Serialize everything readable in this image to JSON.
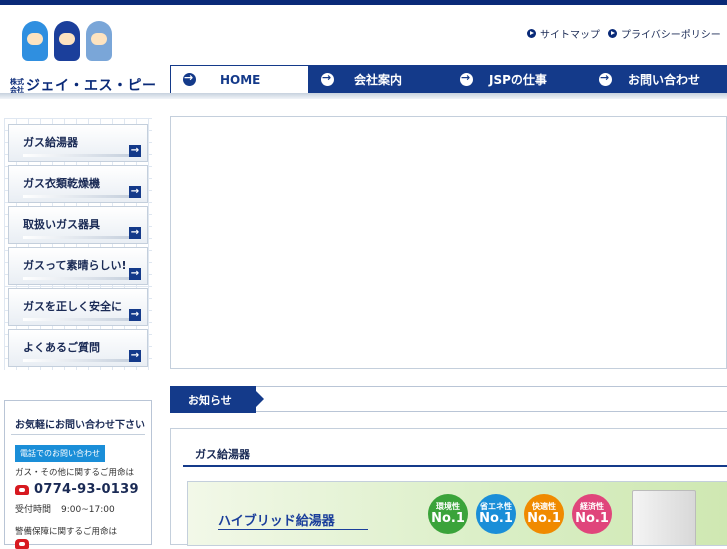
{
  "logo": {
    "company_prefix": "株式会社",
    "company_name": "ジェイ・エス・ピー"
  },
  "utility_links": [
    {
      "label": "サイトマップ"
    },
    {
      "label": "プライバシーポリシー"
    }
  ],
  "nav": [
    {
      "label": "HOME",
      "active": true
    },
    {
      "label": "会社案内",
      "active": false
    },
    {
      "label": "JSPの仕事",
      "active": false
    },
    {
      "label": "お問い合わせ",
      "active": false
    }
  ],
  "sidebar": {
    "items": [
      {
        "label": "ガス給湯器"
      },
      {
        "label": "ガス衣類乾燥機"
      },
      {
        "label": "取扱いガス器具"
      },
      {
        "label": "ガスって素晴らしい!"
      },
      {
        "label": "ガスを正しく安全に"
      },
      {
        "label": "よくあるご質問"
      }
    ]
  },
  "contact": {
    "title": "お気軽にお問い合わせ下さい",
    "badge": "電話でのお問い合わせ",
    "note1": "ガス・その他に関するご用命は",
    "phone1": "0774-93-0139",
    "hours_label": "受付時間",
    "hours_value": "9:00~17:00",
    "note2": "警備保障に関するご用命は"
  },
  "news": {
    "label": "お知らせ"
  },
  "section": {
    "title": "ガス給湯器",
    "banner_title": "ハイブリッド給湯器",
    "badges": [
      {
        "label": "環境性",
        "rank": "No.1",
        "color": "#3aa33a"
      },
      {
        "label": "省エネ性",
        "rank": "No.1",
        "color": "#1a8ed8"
      },
      {
        "label": "快適性",
        "rank": "No.1",
        "color": "#f08a00"
      },
      {
        "label": "経済性",
        "rank": "No.1",
        "color": "#e0457b"
      }
    ]
  },
  "colors": {
    "brand_navy": "#143a8a",
    "top_bar": "#0a2a78",
    "badge_blue": "#1a8ed8",
    "phone_red": "#d71920"
  }
}
